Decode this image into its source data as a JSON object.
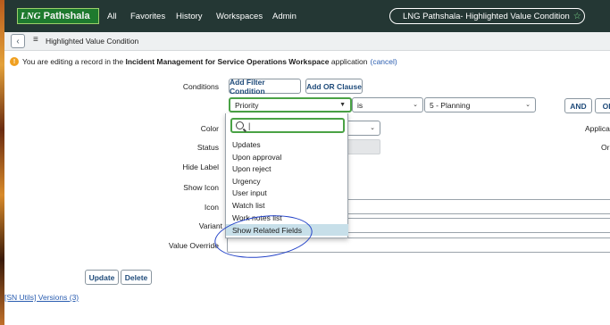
{
  "header": {
    "logo_lng": "LNG",
    "logo_name": "Pathshala",
    "nav": [
      "All",
      "Favorites",
      "History",
      "Workspaces",
      "Admin"
    ],
    "context_title": "LNG Pathshala- Highlighted Value Condition",
    "star_icon": "star-icon"
  },
  "subheader": {
    "back_icon": "chevron-left-icon",
    "menu_icon": "hamburger-icon",
    "form_title": "Highlighted Value Condition"
  },
  "notice": {
    "icon": "warning-icon",
    "prefix": "You are editing a record in the",
    "app_name": "Incident Management for Service Operations Workspace",
    "suffix": "application",
    "cancel": "(cancel)"
  },
  "conditions": {
    "label": "Conditions",
    "add_filter": "Add Filter Condition",
    "add_or": "Add OR Clause",
    "field_value": "Priority",
    "operator_value": "is",
    "value_value": "5 - Planning",
    "and_btn": "AND",
    "or_btn": "OR"
  },
  "dropdown": {
    "search_value": "|",
    "items": [
      "Updates",
      "Upon approval",
      "Upon reject",
      "Urgency",
      "User input",
      "Watch list",
      "Work notes list",
      "Show Related Fields"
    ],
    "highlighted_index": 7
  },
  "form": {
    "color_label": "Color",
    "status_label": "Status",
    "status_value": "I",
    "hide_label": "Hide Label",
    "show_icon_label": "Show Icon",
    "icon_label": "Icon",
    "variant_label": "Variant",
    "value_override_label": "Value Override",
    "right_label_app": "Applicati",
    "right_label_or": "Or"
  },
  "actions": {
    "update": "Update",
    "delete": "Delete"
  },
  "footer": {
    "related_links": "[SN Utils] Versions (3)"
  },
  "colors": {
    "topbar": "#243734",
    "accent_green": "#4aa245",
    "link_blue": "#2a5db0",
    "annotation_blue": "#2544c8"
  }
}
